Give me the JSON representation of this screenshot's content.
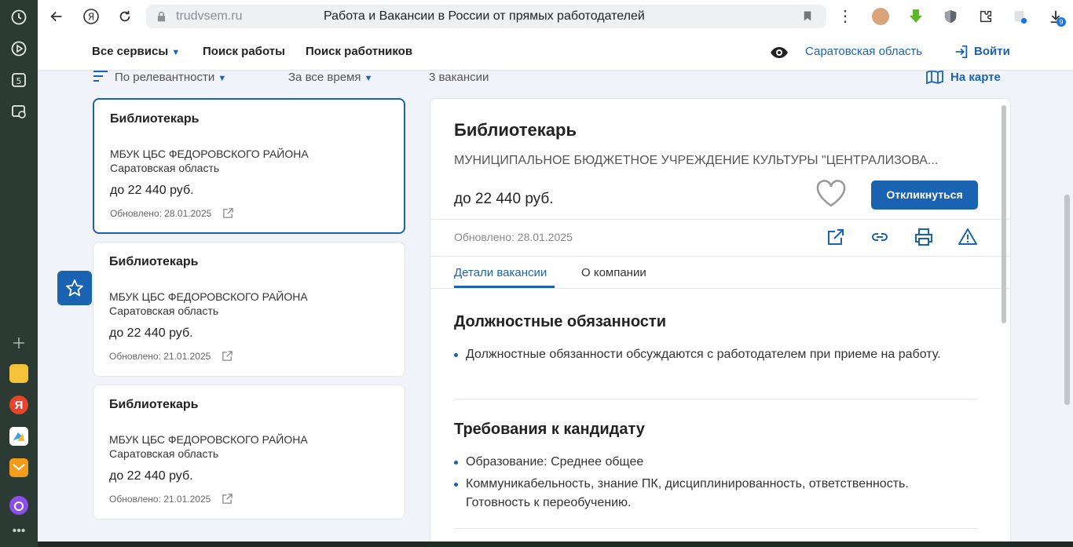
{
  "browser": {
    "url_host": "trudvsem.ru",
    "page_title": "Работа и Вакансии в России от прямых работодателей",
    "ext_badge": "9"
  },
  "nav": {
    "all_services": "Все сервисы",
    "find_job": "Поиск работы",
    "find_workers": "Поиск работников",
    "region": "Саратовская область",
    "login": "Войти"
  },
  "filters": {
    "sort": "По релевантности",
    "period": "За все время",
    "count": "3 вакансии",
    "map": "На карте"
  },
  "vacancies": [
    {
      "title": "Библиотекарь",
      "company": "МБУК ЦБС ФЕДОРОВСКОГО РАЙОНА",
      "region": "Саратовская область",
      "salary": "до 22 440 руб.",
      "updated": "Обновлено: 28.01.2025"
    },
    {
      "title": "Библиотекарь",
      "company": "МБУК ЦБС ФЕДОРОВСКОГО РАЙОНА",
      "region": "Саратовская область",
      "salary": "до 22 440 руб.",
      "updated": "Обновлено: 21.01.2025"
    },
    {
      "title": "Библиотекарь",
      "company": "МБУК ЦБС ФЕДОРОВСКОГО РАЙОНА",
      "region": "Саратовская область",
      "salary": "до 22 440 руб.",
      "updated": "Обновлено: 21.01.2025"
    }
  ],
  "detail": {
    "title": "Библиотекарь",
    "company": "МУНИЦИПАЛЬНОЕ БЮДЖЕТНОЕ УЧРЕЖДЕНИЕ КУЛЬТУРЫ \"ЦЕНТРАЛИЗОВА...",
    "salary": "до 22 440 руб.",
    "respond": "Откликнуться",
    "updated": "Обновлено: 28.01.2025",
    "tabs": [
      "Детали вакансии",
      "О компании"
    ],
    "duties_title": "Должностные обязанности",
    "duties": [
      "Должностные обязанности обсуждаются с работодателем при приеме на работу."
    ],
    "req_title": "Требования к кандидату",
    "reqs": [
      "Образование: Среднее общее",
      "Коммуникабельность, знание ПК, дисциплинированность, ответственность. Готовность к переобучению."
    ]
  },
  "colors": {
    "accent": "#1a63b0",
    "sidebar": "#2b3a33"
  }
}
